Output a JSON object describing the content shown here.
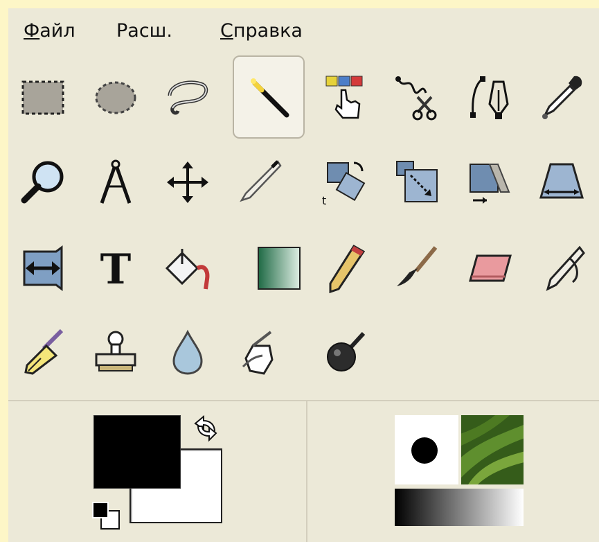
{
  "menubar": {
    "items": [
      {
        "mnemonic": "Ф",
        "rest": "айл"
      },
      {
        "mnemonic": "",
        "rest": "Расш."
      },
      {
        "mnemonic": "С",
        "rest": "правка"
      }
    ]
  },
  "tools": {
    "rows": [
      [
        "rect-select-icon",
        "ellipse-select-icon",
        "free-select-icon",
        "fuzzy-select-icon",
        "select-by-color-icon",
        "scissors-select-icon",
        "paths-icon",
        "color-picker-icon"
      ],
      [
        "zoom-icon",
        "measure-icon",
        "move-icon",
        "crop-icon",
        "rotate-icon",
        "scale-icon",
        "shear-icon",
        "perspective-icon"
      ],
      [
        "flip-icon",
        "text-icon",
        "bucket-fill-icon",
        "blend-icon",
        "pencil-icon",
        "paintbrush-icon",
        "eraser-icon",
        "airbrush-icon"
      ],
      [
        "ink-icon",
        "clone-icon",
        "blur-icon",
        "smudge-icon",
        "dodge-burn-icon"
      ]
    ],
    "active": "fuzzy-select-icon",
    "text_tool_glyph": "T"
  },
  "colors": {
    "foreground": "#000000",
    "background": "#ffffff"
  },
  "brushes": {
    "gradient_from": "#000000",
    "gradient_to": "#ffffff"
  }
}
